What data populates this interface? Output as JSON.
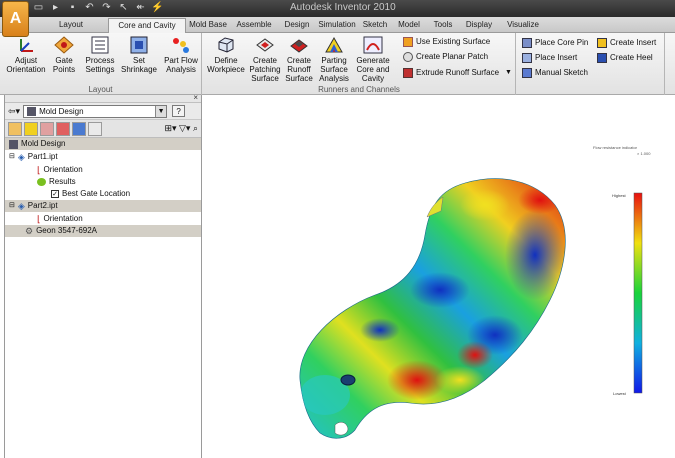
{
  "app": {
    "title": "Autodesk Inventor 2010",
    "menu_letter": "A"
  },
  "tabs": [
    {
      "label": "Layout"
    },
    {
      "label": "Core and Cavity"
    },
    {
      "label": "Mold Base"
    },
    {
      "label": "Assemble"
    },
    {
      "label": "Design"
    },
    {
      "label": "Simulation"
    },
    {
      "label": "Sketch"
    },
    {
      "label": "Model"
    },
    {
      "label": "Tools"
    },
    {
      "label": "Display"
    },
    {
      "label": "Visualize"
    }
  ],
  "ribbon": {
    "layout_panel": {
      "label": "Layout",
      "buttons": [
        {
          "label": "Adjust Orientation",
          "icon": "adjust-orientation-icon"
        },
        {
          "label": "Gate Points",
          "icon": "gate-points-icon"
        },
        {
          "label": "Process Settings",
          "icon": "process-settings-icon"
        },
        {
          "label": "Set Shrinkage",
          "icon": "set-shrinkage-icon"
        },
        {
          "label": "Part Flow Analysis",
          "icon": "part-flow-analysis-icon"
        }
      ]
    },
    "runners_panel": {
      "label": "Runners and Channels",
      "buttons": [
        {
          "label": "Define Workpiece",
          "icon": "define-workpiece-icon"
        },
        {
          "label": "Create Patching Surface",
          "icon": "patching-surface-icon"
        },
        {
          "label": "Create Runoff Surface",
          "icon": "runoff-surface-icon"
        },
        {
          "label": "Parting Surface Analysis",
          "icon": "parting-analysis-icon"
        },
        {
          "label": "Generate Core and Cavity",
          "icon": "generate-core-cavity-icon"
        }
      ],
      "small_buttons": [
        {
          "label": "Use Existing Surface",
          "icon": "existing-surface-icon"
        },
        {
          "label": "Create Planar Patch",
          "icon": "planar-patch-icon"
        },
        {
          "label": "Extrude Runoff Surface",
          "icon": "extrude-runoff-icon"
        }
      ]
    },
    "insert_panel": {
      "col1": [
        {
          "label": "Place Core Pin",
          "icon": "core-pin-icon"
        },
        {
          "label": "Place Insert",
          "icon": "place-insert-icon"
        },
        {
          "label": "Manual Sketch",
          "icon": "manual-sketch-icon"
        }
      ],
      "col2": [
        {
          "label": "Create Insert",
          "icon": "create-insert-icon"
        },
        {
          "label": "Create Heel",
          "icon": "create-heel-icon"
        }
      ]
    }
  },
  "browser": {
    "selector": "Mold Design",
    "help": "?",
    "close": "×",
    "tree": [
      {
        "label": "Mold Design"
      },
      {
        "label": "Part1.ipt"
      },
      {
        "label": "Orientation"
      },
      {
        "label": "Results"
      },
      {
        "label": "Best Gate Location"
      },
      {
        "label": "Part2.ipt"
      },
      {
        "label": "Orientation"
      },
      {
        "label": "Geon 3547-692A"
      }
    ]
  },
  "viewport": {
    "legend_title": "Flow resistance indicator",
    "legend_subtitle": "× 1.000",
    "legend_high": "Highest",
    "legend_low": "Lowest",
    "colors": {
      "high": "#e81010",
      "mid": "#19d33a",
      "low": "#1018e8"
    }
  }
}
